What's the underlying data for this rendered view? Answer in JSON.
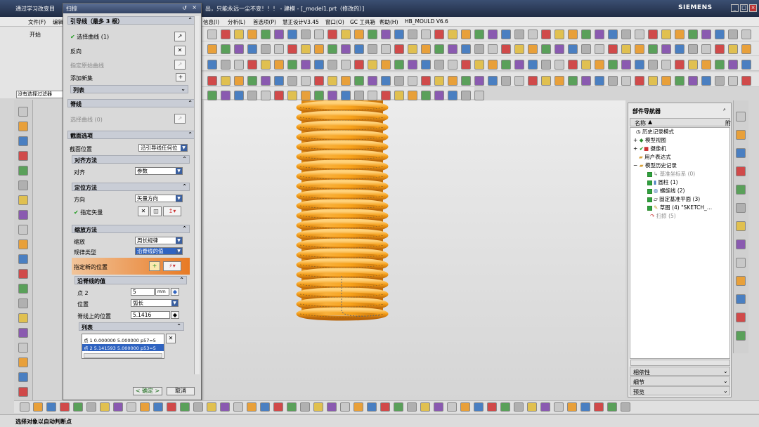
{
  "window": {
    "title_left": "通过学习改变目",
    "title_center": "出，只能永远一尘不变！！！ - 建模 - [_model1.prt（修改的）]",
    "brand": "SIEMENS"
  },
  "menus": [
    {
      "label": "文件(F)"
    },
    {
      "label": "编辑"
    },
    {
      "label": "信息(I)"
    },
    {
      "label": "分析(L)"
    },
    {
      "label": "首选项(P)"
    },
    {
      "label": "慧正设计V3.45"
    },
    {
      "label": "窗口(O)"
    },
    {
      "label": "GC 工具箱"
    },
    {
      "label": "帮助(H)"
    },
    {
      "label": "HB_MOULD V6.6"
    }
  ],
  "toolbar_left": {
    "start_label": "开始",
    "filter_label": "没有选择过滤器"
  },
  "dialog": {
    "title": "扫掠",
    "guide": {
      "header": "引导线（最多 3 根）",
      "select_curve": "选择曲线 (1)",
      "reverse": "反向",
      "specify_origin_curve": "指定原始曲线",
      "add_new": "添加新集",
      "list": "列表"
    },
    "spine": {
      "header": "脊线",
      "select_curve": "选择曲线 (0)"
    },
    "section_options": {
      "header": "截面选项",
      "section_position_label": "截面位置",
      "section_position_value": "沿引导线任何位",
      "alignment": {
        "header": "对齐方法",
        "align_label": "对齐",
        "align_value": "参数"
      },
      "orientation": {
        "header": "定位方法",
        "direction_label": "方向",
        "direction_value": "矢量方向",
        "specify_vector": "指定矢量"
      },
      "scaling": {
        "header": "缩放方法",
        "scale_label": "缩放",
        "scale_value": "周长规律",
        "law_type_label": "规律类型",
        "law_type_value": "沿脊线的值",
        "specify_new_position": "指定新的位置",
        "along_spine": {
          "header": "沿脊线的值",
          "point_label": "点 2",
          "point_value": "5",
          "unit": "mm",
          "location_label": "位置",
          "location_value": "弧长",
          "spine_pos_label": "脊线上的位置",
          "spine_pos_value": "5.1416",
          "list_header": "列表",
          "rows": [
            {
              "point": "点 1",
              "v1": "0.000000",
              "v2": "5.000000",
              "v3": "p57=5"
            },
            {
              "point": "点 2",
              "v1": "5.141593",
              "v2": "5.000000",
              "v3": "p53=5"
            }
          ]
        }
      }
    },
    "ok_label": "< 确定 >",
    "cancel_label": "取消"
  },
  "navigator": {
    "title": "部件导航器",
    "col_name": "名称",
    "col_extra": "附",
    "rows": [
      {
        "label": "历史记录模式",
        "indent": 1
      },
      {
        "label": "模型视图",
        "indent": 1
      },
      {
        "label": "摄像机",
        "indent": 1
      },
      {
        "label": "用户表达式",
        "indent": 1
      },
      {
        "label": "模型历史记录",
        "indent": 1
      },
      {
        "label": "基准坐标系 (0)",
        "indent": 2,
        "muted": true
      },
      {
        "label": "圆柱 (1)",
        "indent": 2
      },
      {
        "label": "螺旋线 (2)",
        "indent": 2
      },
      {
        "label": "固定基准平面 (3)",
        "indent": 2
      },
      {
        "label": "草图 (4) \"SKETCH_…",
        "indent": 2
      },
      {
        "label": "扫掠 (5)",
        "indent": 2,
        "muted": true
      }
    ],
    "bottom_sections": [
      {
        "label": "相依性"
      },
      {
        "label": "细节"
      },
      {
        "label": "预览"
      }
    ]
  },
  "status": {
    "text": "选择对象以自动判断点"
  },
  "colors": {
    "spring": "#f7a21b",
    "title_bar": "#26334d",
    "accent": "#3a5f9f"
  }
}
